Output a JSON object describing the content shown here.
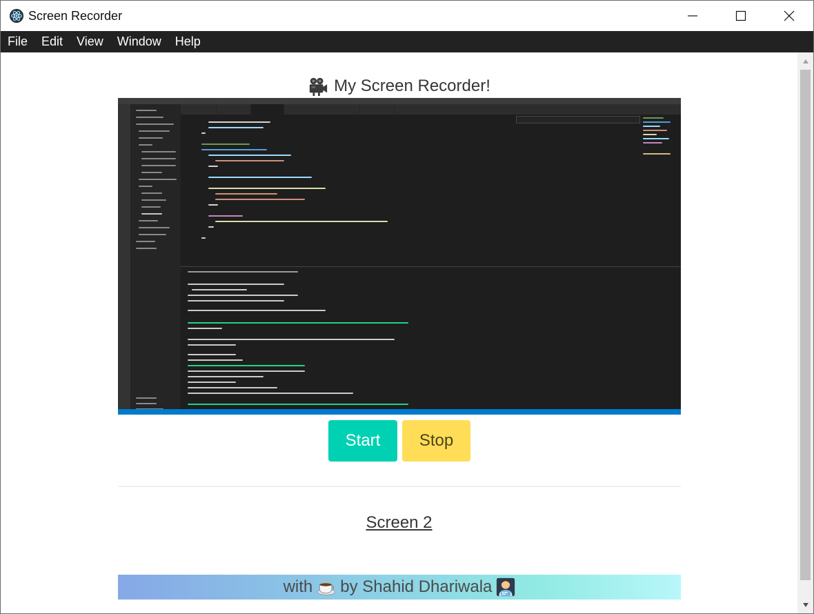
{
  "window": {
    "title": "Screen Recorder",
    "app_icon": "electron-atom-icon",
    "controls": [
      "minimize-icon",
      "maximize-icon",
      "close-icon"
    ]
  },
  "menu": {
    "items": [
      {
        "label": "File"
      },
      {
        "label": "Edit"
      },
      {
        "label": "View"
      },
      {
        "label": "Window"
      },
      {
        "label": "Help"
      }
    ]
  },
  "page": {
    "title": "My Screen Recorder!",
    "title_icon": "movie-camera-icon"
  },
  "preview": {
    "description_icon": "video-preview"
  },
  "buttons": {
    "start_label": "Start",
    "stop_label": "Stop"
  },
  "link": {
    "label": "Screen 2"
  },
  "footer": {
    "prefix": "with",
    "coffee_icon": "coffee-icon",
    "credit": "by Shahid Dhariwala",
    "developer_icon": "developer-icon"
  },
  "colors": {
    "menubar": "#222222",
    "start": "#00d1b2",
    "stop": "#ffdd57",
    "footer_gradient_start": "#86a8e7",
    "footer_gradient_end": "#b8f7fa"
  }
}
